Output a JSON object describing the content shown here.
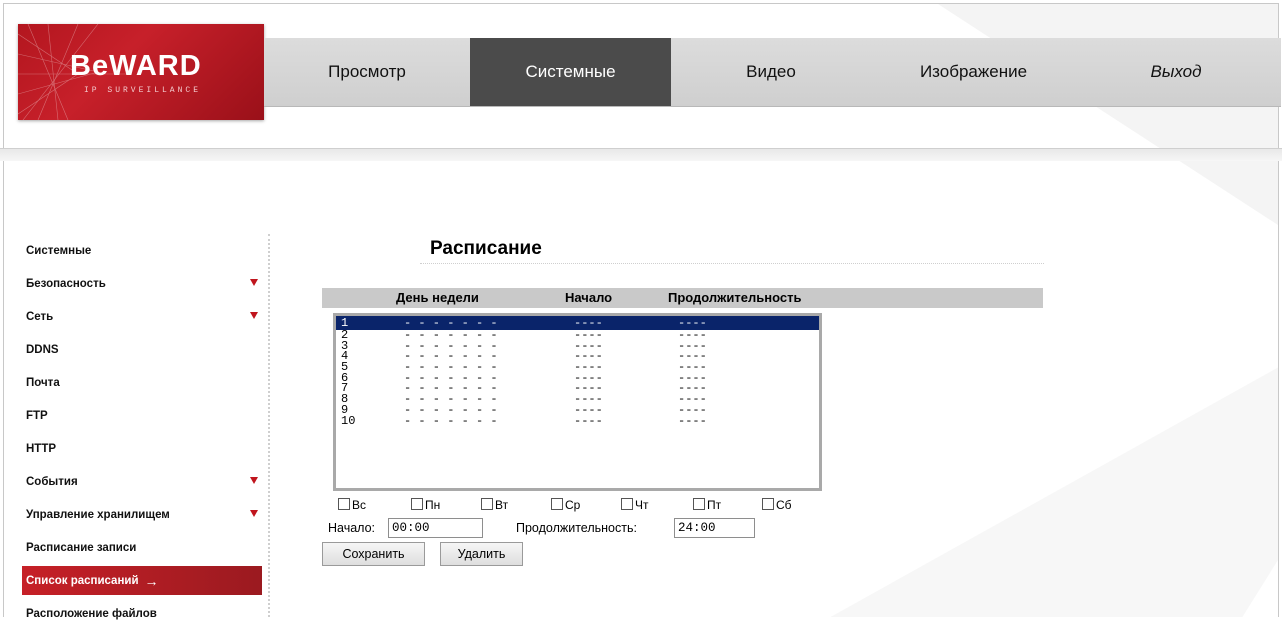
{
  "brand": {
    "logo_text": "BeWARD",
    "logo_sub": "IP SURVEILLANCE"
  },
  "topnav": {
    "items": [
      {
        "label": "Просмотр"
      },
      {
        "label": "Системные"
      },
      {
        "label": "Видео"
      },
      {
        "label": "Изображение"
      },
      {
        "label": "Выход"
      }
    ],
    "active": "Системные"
  },
  "sidebar": {
    "items": [
      {
        "label": "Системные",
        "expandable": false
      },
      {
        "label": "Безопасность",
        "expandable": true
      },
      {
        "label": "Сеть",
        "expandable": true
      },
      {
        "label": "DDNS",
        "expandable": false
      },
      {
        "label": "Почта",
        "expandable": false
      },
      {
        "label": "FTP",
        "expandable": false
      },
      {
        "label": "HTTP",
        "expandable": false
      },
      {
        "label": "События",
        "expandable": true
      },
      {
        "label": "Управление хранилищем",
        "expandable": true
      },
      {
        "label": "Расписание записи",
        "expandable": false
      },
      {
        "label": "Список расписаний",
        "expandable": false,
        "active": true
      },
      {
        "label": "Расположение файлов",
        "expandable": false
      }
    ],
    "active_arrow": "→"
  },
  "main": {
    "title": "Расписание",
    "columns": [
      "День недели",
      "Начало",
      "Продолжительность"
    ],
    "rows": [
      {
        "num": "1",
        "days": "- - - - - - -",
        "start": "----",
        "duration": "----"
      },
      {
        "num": "2",
        "days": "- - - - - - -",
        "start": "----",
        "duration": "----"
      },
      {
        "num": "3",
        "days": "- - - - - - -",
        "start": "----",
        "duration": "----"
      },
      {
        "num": "4",
        "days": "- - - - - - -",
        "start": "----",
        "duration": "----"
      },
      {
        "num": "5",
        "days": "- - - - - - -",
        "start": "----",
        "duration": "----"
      },
      {
        "num": "6",
        "days": "- - - - - - -",
        "start": "----",
        "duration": "----"
      },
      {
        "num": "7",
        "days": "- - - - - - -",
        "start": "----",
        "duration": "----"
      },
      {
        "num": "8",
        "days": "- - - - - - -",
        "start": "----",
        "duration": "----"
      },
      {
        "num": "9",
        "days": "- - - - - - -",
        "start": "----",
        "duration": "----"
      },
      {
        "num": "10",
        "days": "- - - - - - -",
        "start": "----",
        "duration": "----"
      }
    ],
    "selected_row": "1",
    "days": [
      "Вс",
      "Пн",
      "Вт",
      "Ср",
      "Чт",
      "Пт",
      "Сб"
    ],
    "start_label": "Начало:",
    "start_value": "00:00",
    "duration_label": "Продолжительность:",
    "duration_value": "24:00",
    "save_label": "Сохранить",
    "delete_label": "Удалить"
  },
  "colors": {
    "brand_red": "#c7202a",
    "nav_active": "#4b4b4b",
    "selection": "#0a246a"
  }
}
